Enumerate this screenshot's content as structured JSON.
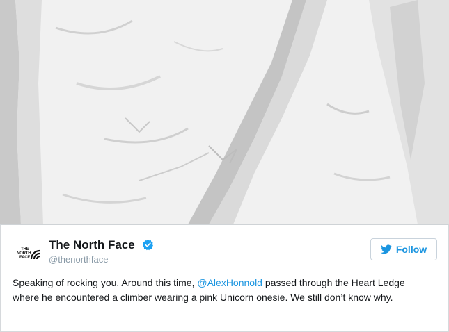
{
  "tweet": {
    "display_name": "The North Face",
    "handle": "@thenorthface",
    "follow_label": "Follow",
    "logo_lines": [
      "THE",
      "NORTH",
      "FACE"
    ],
    "text_before": "Speaking of rocking you. Around this time, ",
    "mention": "@AlexHonnold",
    "text_after": " passed through the Heart Ledge where he encountered a climber wearing a pink Unicorn onesie. We still don’t know why.",
    "verified_icon": "verified-badge-icon",
    "bird_icon": "twitter-bird-icon"
  },
  "colors": {
    "link": "#1b95e0",
    "secondary_text": "#8899a6",
    "verified": "#1da1f2"
  }
}
